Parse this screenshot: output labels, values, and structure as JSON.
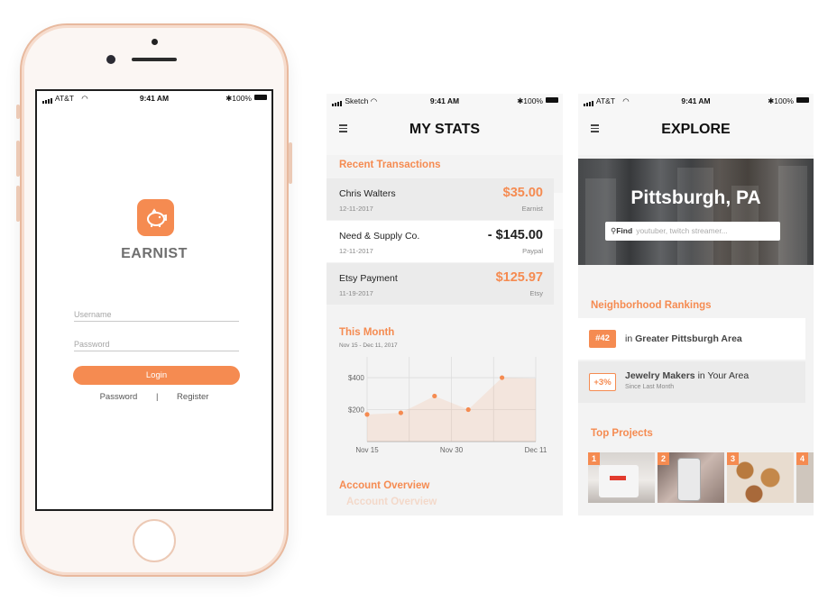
{
  "login_screen": {
    "status": {
      "carrier": "AT&T",
      "time": "9:41 AM",
      "battery": "100%"
    },
    "app_name": "EARNIST",
    "username_placeholder": "Username",
    "password_placeholder": "Password",
    "login_label": "Login",
    "password_link": "Password",
    "separator": "|",
    "register_link": "Register"
  },
  "stats_screen": {
    "status": {
      "carrier": "Sketch",
      "time": "9:41 AM",
      "battery": "100%"
    },
    "title": "MY STATS",
    "recent_title": "Recent Transactions",
    "transactions": [
      {
        "name": "Chris Walters",
        "date": "12-11-2017",
        "amount": "$35.00",
        "source": "Earnist",
        "color": "#f58b51"
      },
      {
        "name": "Need & Supply Co.",
        "date": "12-11-2017",
        "amount": "- $145.00",
        "source": "Paypal",
        "color": "#222222"
      },
      {
        "name": "Etsy Payment",
        "date": "11-19-2017",
        "amount": "$125.97",
        "source": "Etsy",
        "color": "#f58b51"
      }
    ],
    "month_title": "This Month",
    "month_range": "Nov 15 - Dec 11, 2017",
    "account_title": "Account Overview"
  },
  "chart_data": {
    "type": "area",
    "title": "This Month",
    "x": [
      "Nov 15",
      "Nov 18",
      "Nov 24",
      "Nov 30",
      "Dec 5",
      "Dec 11"
    ],
    "x_ticks": [
      "Nov 15",
      "Nov 30",
      "Dec 11"
    ],
    "y_ticks": [
      "$400",
      "$200"
    ],
    "values": [
      170,
      180,
      285,
      200,
      400,
      395
    ],
    "ylim": [
      0,
      530
    ],
    "grid": true,
    "color": "#f58b51"
  },
  "explore_screen": {
    "status": {
      "carrier": "AT&T",
      "time": "9:41 AM",
      "battery": "100%"
    },
    "title": "EXPLORE",
    "city": "Pittsburgh, PA",
    "find_label": "Find",
    "find_placeholder": "youtuber, twitch streamer...",
    "rankings_title": "Neighborhood Rankings",
    "rankings": [
      {
        "badge": "#42",
        "prefix": "in",
        "bold": "Greater Pittsburgh Area",
        "suffix": "",
        "sub": ""
      },
      {
        "badge": "+3%",
        "prefix": "",
        "bold": "Jewelry Makers",
        "suffix": "in Your Area",
        "sub": "Since Last Month"
      }
    ],
    "projects_title": "Top Projects",
    "projects": [
      "1",
      "2",
      "3",
      "4"
    ]
  },
  "colors": {
    "accent": "#f58b51",
    "frame": "#e8b99e"
  }
}
